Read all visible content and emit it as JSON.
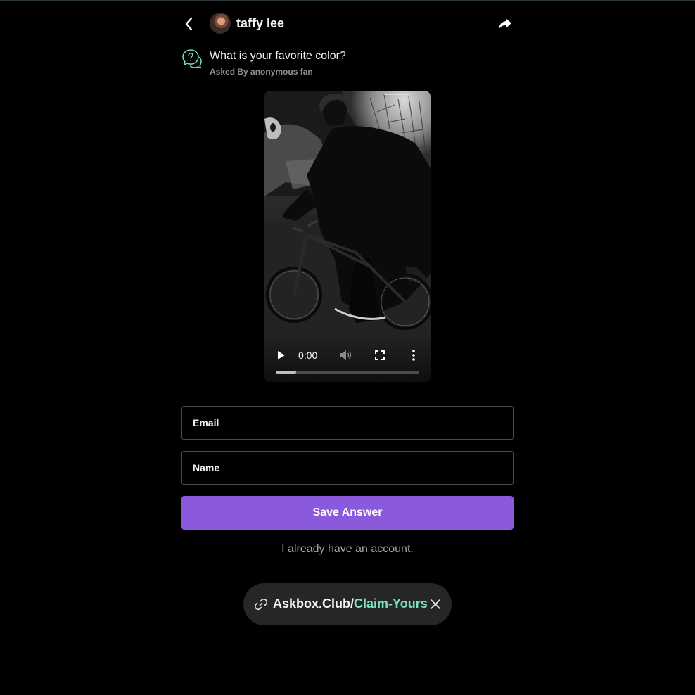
{
  "header": {
    "username": "taffy lee"
  },
  "question": {
    "text": "What is your favorite color?",
    "asker": "Asked By anonymous fan"
  },
  "video": {
    "time": "0:00",
    "progress_fraction": 0.14
  },
  "form": {
    "email_placeholder": "Email",
    "name_placeholder": "Name",
    "email_value": "",
    "name_value": "",
    "save_label": "Save Answer",
    "account_link": "I already have an account."
  },
  "claim": {
    "base": "Askbox.Club/",
    "accent": "Claim-Yours"
  },
  "colors": {
    "accent_purple": "#8a59dc",
    "accent_teal": "#7ee0c6"
  },
  "icons": {
    "back": "chevron-left-icon",
    "share": "share-arrow-icon",
    "question": "question-bubble-icon",
    "play": "play-icon",
    "mute": "volume-icon",
    "fullscreen": "fullscreen-icon",
    "more": "more-vertical-icon",
    "link": "link-icon",
    "close": "close-icon"
  }
}
